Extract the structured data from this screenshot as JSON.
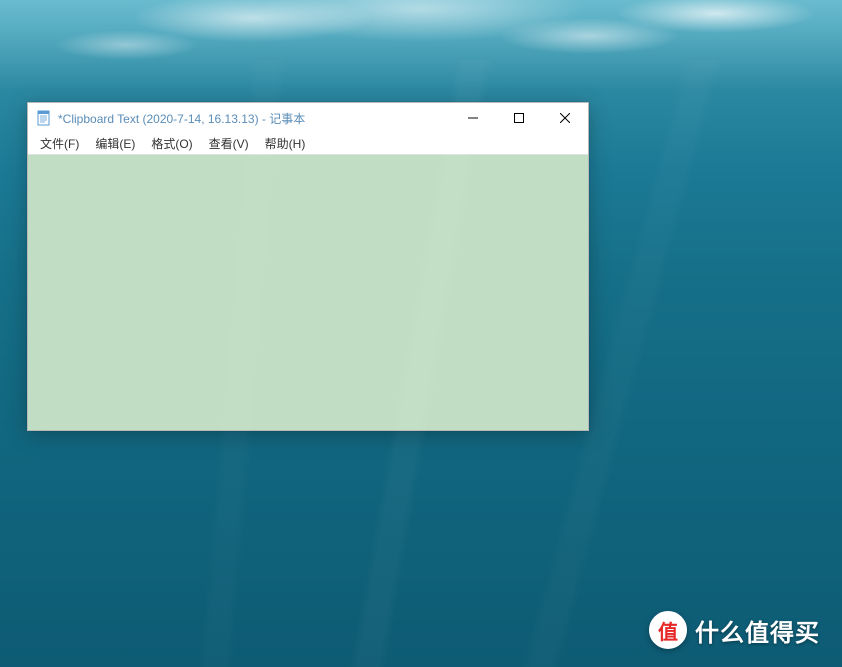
{
  "window": {
    "title": "*Clipboard Text (2020-7-14, 16.13.13) - 记事本",
    "icon": "notepad-icon"
  },
  "menu": {
    "file": "文件(F)",
    "edit": "编辑(E)",
    "format": "格式(O)",
    "view": "查看(V)",
    "help": "帮助(H)"
  },
  "editor": {
    "content": "",
    "background_color": "#c1dec4"
  },
  "watermark": {
    "badge_char": "值",
    "text": "什么值得买"
  }
}
